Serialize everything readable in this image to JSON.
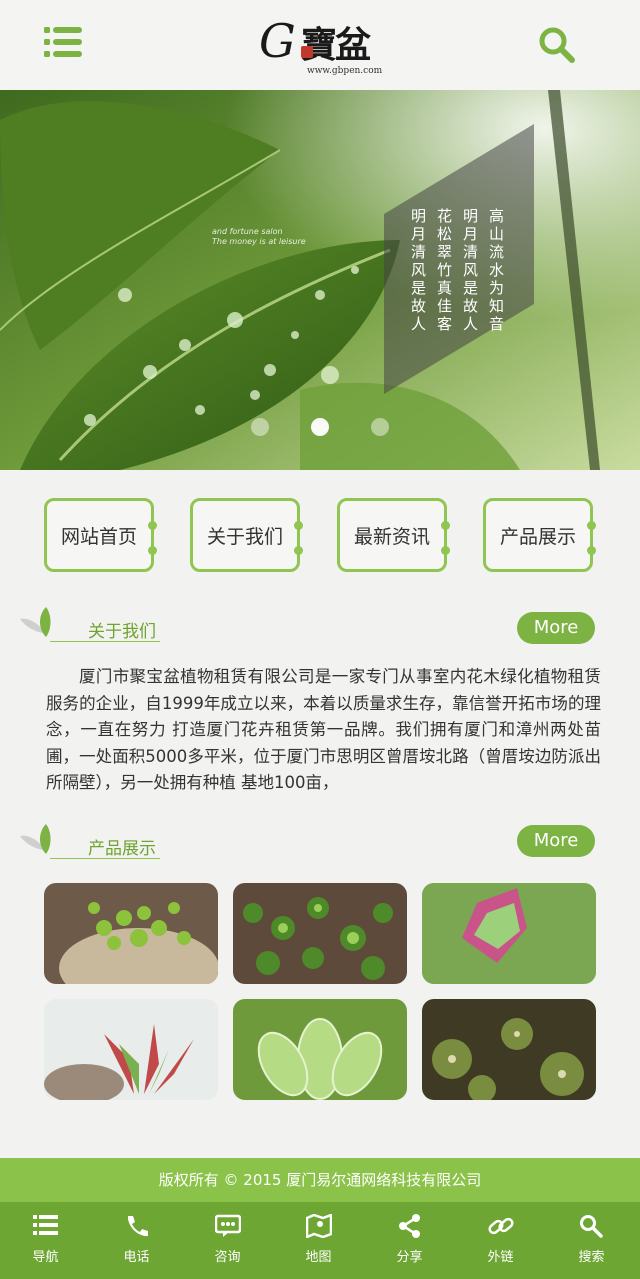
{
  "header": {
    "logo_letter": "G",
    "logo_text": "寶盆",
    "logo_url": "www.gbpen.com"
  },
  "banner": {
    "caption_line1": "and fortune salon",
    "caption_line2": "The money is at leisure",
    "poem": [
      "高山流水为知音",
      "明月清风是故人",
      "花松翠竹真佳客",
      "明月清风是故人"
    ],
    "dots": 3,
    "active_dot": 1
  },
  "nav": [
    "网站首页",
    "关于我们",
    "最新资讯",
    "产品展示"
  ],
  "about": {
    "title": "关于我们",
    "more": "More",
    "text": "厦门市聚宝盆植物租赁有限公司是一家专门从事室内花木绿化植物租赁服务的企业，自1999年成立以来，本着以质量求生存，靠信誉开拓市场的理念，一直在努力 打造厦门花卉租赁第一品牌。我们拥有厦门和漳州两处苗圃，一处面积5000多平米，位于厦门市思明区曾厝垵北路（曾厝垵边防派出所隔壁），另一处拥有种植  基地100亩，"
  },
  "products": {
    "title": "产品展示",
    "more": "More"
  },
  "footer": {
    "copyright": "版权所有 © 2015 厦门易尔通网络科技有限公司"
  },
  "tabs": [
    {
      "label": "导航",
      "icon": "list-icon"
    },
    {
      "label": "电话",
      "icon": "phone-icon"
    },
    {
      "label": "咨询",
      "icon": "chat-icon"
    },
    {
      "label": "地图",
      "icon": "map-icon"
    },
    {
      "label": "分享",
      "icon": "share-icon"
    },
    {
      "label": "外链",
      "icon": "link-icon"
    },
    {
      "label": "搜索",
      "icon": "search-icon"
    }
  ],
  "colors": {
    "accent": "#8fc550",
    "footer_bar": "#8bc34a",
    "tab_bar": "#6ea633"
  }
}
